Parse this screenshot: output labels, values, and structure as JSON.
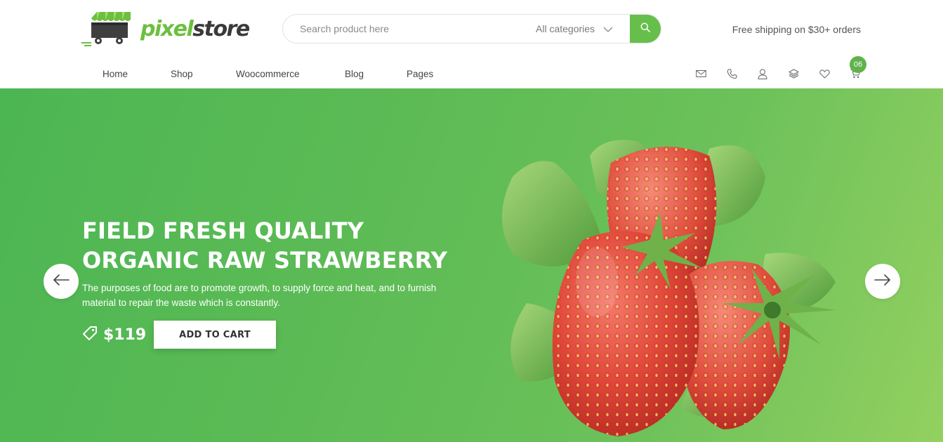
{
  "brand": {
    "name_part1": "pixel",
    "name_part2": "store",
    "colors": {
      "green": "#6cbf3f",
      "dark": "#3a3a3a"
    }
  },
  "search": {
    "placeholder": "Search product here",
    "category": "All categories",
    "button_icon": "search-icon"
  },
  "shipping_text": "Free shipping on $30+ orders",
  "nav": {
    "items": [
      {
        "label": "Home"
      },
      {
        "label": "Shop"
      },
      {
        "label": "Woocommerce"
      },
      {
        "label": "Blog"
      },
      {
        "label": "Pages"
      }
    ],
    "icons": [
      "mail-icon",
      "phone-icon",
      "user-icon",
      "layers-icon",
      "heart-icon",
      "cart-icon"
    ],
    "cart_count": "06"
  },
  "hero": {
    "title_line1": "FIELD FRESH QUALITY",
    "title_line2": "ORGANIC RAW STRAWBERRY",
    "description": "The purposes of food are to promote growth, to supply force and heat, and to furnish material to repair the waste which is constantly.",
    "price": "$119",
    "cta": "ADD TO CART",
    "colors": {
      "accent": "#5fb34a",
      "background_start": "#4cb653",
      "background_end": "#93d060"
    }
  }
}
